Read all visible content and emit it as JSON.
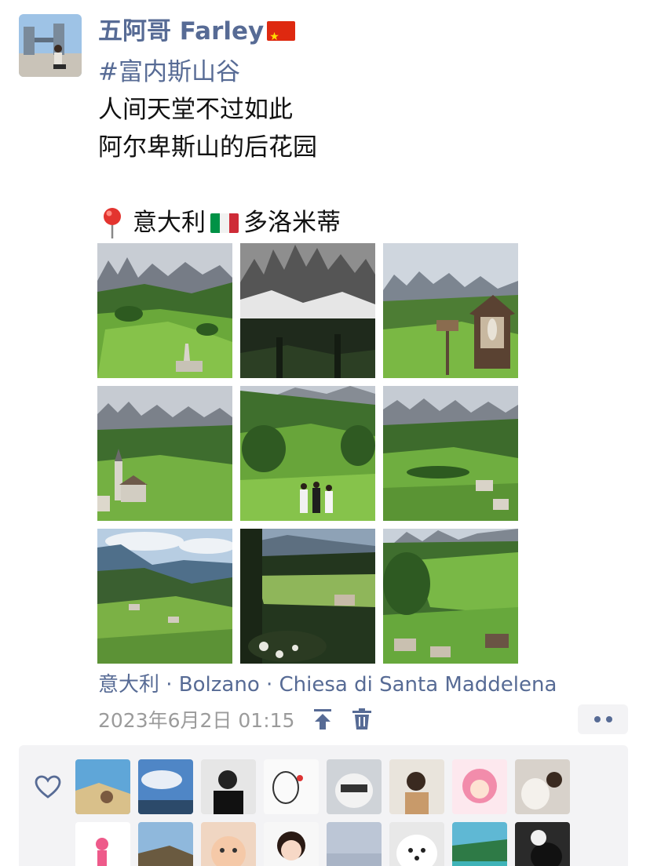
{
  "post": {
    "author": "五阿哥 Farley",
    "hashtag": "#富内斯山谷",
    "lines": [
      "人间天堂不过如此",
      "阿尔卑斯山的后花园"
    ],
    "place_prefix": "意大利",
    "place_suffix": "多洛米蒂",
    "location": "意大利 · Bolzano · Chiesa di Santa Maddelena",
    "timestamp": "2023年6月2日 01:15",
    "photo_count": 9,
    "likers_visible": 16
  },
  "colors": {
    "link": "#576b95",
    "timestamp": "#9b9b9b",
    "likes_bg": "#f3f3f5"
  },
  "icons": [
    "location-pin-icon",
    "flag-china-icon",
    "flag-italy-icon",
    "pin-top-icon",
    "trash-icon",
    "more-dots-icon",
    "heart-icon"
  ]
}
